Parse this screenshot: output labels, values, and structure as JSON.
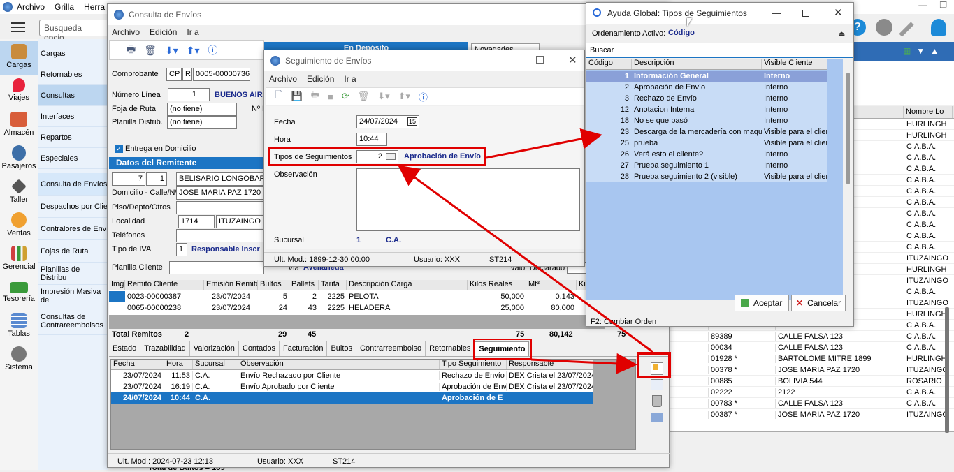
{
  "app_menu": [
    "Archivo",
    "Grilla",
    "Herra"
  ],
  "search_placeholder": "Busqueda opcio",
  "sidebar": [
    "Cargas",
    "Viajes",
    "Almacén",
    "Pasajeros",
    "Taller",
    "Ventas",
    "Gerencial",
    "Tesorería",
    "Tablas",
    "Sistema"
  ],
  "submenu1": [
    "Cargas",
    "Retornables",
    "Consultas",
    "Interfaces",
    "Repartos",
    "Especiales"
  ],
  "submenu2": [
    "Consulta de Envíos",
    "Despachos por Clie",
    "Contralores de Env",
    "Fojas de Ruta",
    "Planillas de Distribu",
    "Impresión Masiva de",
    "Consultas de Contrareembolsos"
  ],
  "bg_grid": {
    "header": "Nombre Lo",
    "rows": [
      [
        "",
        "",
        "HURLINGH"
      ],
      [
        "",
        "",
        "HURLINGH"
      ],
      [
        "",
        "",
        "C.A.B.A."
      ],
      [
        "",
        "",
        "C.A.B.A."
      ],
      [
        "",
        "",
        "C.A.B.A."
      ],
      [
        "",
        "",
        "C.A.B.A."
      ],
      [
        "",
        "",
        "C.A.B.A."
      ],
      [
        "",
        "1899",
        "C.A.B.A."
      ],
      [
        "",
        "1899",
        "C.A.B.A."
      ],
      [
        "",
        "",
        "C.A.B.A."
      ],
      [
        "",
        "",
        "C.A.B.A."
      ],
      [
        "",
        "",
        "C.A.B.A."
      ],
      [
        "",
        "",
        "ITUZAINGO"
      ],
      [
        "",
        "",
        "HURLINGH"
      ],
      [
        "",
        "",
        "ITUZAINGO"
      ],
      [
        "",
        "",
        "C.A.B.A."
      ],
      [
        "",
        "",
        "ITUZAINGO"
      ],
      [
        "",
        "1899",
        "HURLINGH"
      ],
      [
        "00012",
        "1",
        "C.A.B.A."
      ],
      [
        "89389",
        "CALLE FALSA 123",
        "C.A.B.A."
      ],
      [
        "00034",
        "CALLE FALSA 123",
        "C.A.B.A."
      ],
      [
        "01928 *",
        "BARTOLOME MITRE 1899",
        "HURLINGH"
      ],
      [
        "00378 *",
        "JOSE MARIA PAZ 1720",
        "ITUZAINGO"
      ],
      [
        "00885",
        "BOLIVIA 544",
        "ROSARIO"
      ],
      [
        "02222",
        "2122",
        "C.A.B.A."
      ],
      [
        "00783 *",
        "CALLE FALSA 123",
        "C.A.B.A."
      ],
      [
        "00387 *",
        "JOSE MARIA PAZ 1720",
        "ITUZAINGO"
      ]
    ],
    "footer": "Total de Bultos = 185"
  },
  "consulta": {
    "title": "Consulta de Envíos",
    "menu": [
      "Archivo",
      "Edición",
      "Ir a"
    ],
    "tab_deposito": "En Depósito",
    "tab_novedades": "Novedades",
    "comprobante_label": "Comprobante",
    "cp": "CP",
    "r": "R",
    "numero": "0005-00000736",
    "numero_linea_label": "Número Línea",
    "numero_linea": "1",
    "linea_name": "BUENOS AIRE",
    "foja_label": "Foja de Ruta",
    "foja": "(no tiene)",
    "nro_label": "Nº F",
    "planilla_label": "Planilla Distrib.",
    "planilla": "(no tiene)",
    "entrega_label": "Entrega en Domicilio",
    "remitente_header": "Datos del Remitente",
    "rem_a": "7",
    "rem_b": "1",
    "rem_name": "BELISARIO LONGOBARDI",
    "domicilio_label": "Domicilio - Calle/Nº",
    "domicilio": "JOSE MARIA PAZ 1720",
    "piso_label": "Piso/Depto/Otros",
    "localidad_label": "Localidad",
    "cp_loc": "1714",
    "localidad": "ITUZAINGO",
    "telefonos_label": "Teléfonos",
    "iva_label": "Tipo de IVA",
    "iva_code": "1",
    "iva_name": "Responsable Inscr",
    "planilla_cliente_label": "Planilla Cliente",
    "via_label": "Via",
    "via": "Avellaneda",
    "valor_label": "Valor Declarado",
    "remitos_header": [
      "Img",
      "Remito Cliente",
      "Emisión Remito",
      "Bultos",
      "Pallets",
      "Tarifa",
      "Descripción Carga",
      "Kilos Reales",
      "Mt³",
      "Kilo"
    ],
    "remitos": [
      [
        "",
        "0023-00000387",
        "23/07/2024",
        "5",
        "2",
        "2225",
        "PELOTA",
        "50,000",
        "0,143"
      ],
      [
        "",
        "0065-00000238",
        "23/07/2024",
        "24",
        "43",
        "2225",
        "HELADERA",
        "25,000",
        "80,000"
      ]
    ],
    "total_label": "Total Remitos",
    "total_count": "2",
    "total_bultos": "29",
    "total_pallets": "45",
    "total_kilos": "75",
    "total_mt": "80,142",
    "total_last": "75",
    "bottom_tabs": [
      "Estado",
      "Trazabilidad",
      "Valorización",
      "Contados",
      "Facturación",
      "Bultos",
      "Contrarreembolso",
      "Retornables",
      "Seguimiento"
    ],
    "seg_header": [
      "Fecha",
      "Hora",
      "Sucursal",
      "Observación",
      "Tipo Seguimiento",
      "Responsable"
    ],
    "seg_rows": [
      [
        "23/07/2024",
        "11:53",
        "C.A.",
        "Envío Rechazado por Cliente",
        "Rechazo de Envío",
        "DEX Crista el 23/07/2024"
      ],
      [
        "23/07/2024",
        "16:19",
        "C.A.",
        "Envío Aprobado por Cliente",
        "Aprobación de Envío",
        "DEX Crista el 23/07/2024"
      ],
      [
        "24/07/2024",
        "10:44",
        "C.A.",
        "",
        "Aprobación de E",
        ""
      ]
    ],
    "ult_mod": "Ult. Mod.: 2024-07-23 12:13",
    "usuario": "Usuario: XXX",
    "st": "ST214"
  },
  "seguimiento": {
    "title": "Seguimiento de Envíos",
    "menu": [
      "Archivo",
      "Edición",
      "Ir a"
    ],
    "fecha_label": "Fecha",
    "fecha": "24/07/2024",
    "hora_label": "Hora",
    "hora": "10:44",
    "tipos_label": "Tipos de Seguimientos",
    "tipo_code": "2",
    "tipo_name": "Aprobación de Envío",
    "obs_label": "Observación",
    "sucursal_label": "Sucursal",
    "sucursal_code": "1",
    "sucursal_name": "C.A.",
    "ult_mod": "Ult. Mod.: 1899-12-30 00:00",
    "usuario": "Usuario: XXX",
    "st": "ST214"
  },
  "ayuda": {
    "title": "Ayuda Global: Tipos de Seguimientos",
    "orden_label": "Ordenamiento Activo:",
    "orden_value": "Código",
    "buscar_label": "Buscar",
    "header": [
      "Código",
      "Descripción",
      "Visible Cliente"
    ],
    "rows": [
      [
        "1",
        "Información General",
        "Interno"
      ],
      [
        "2",
        "Aprobación de Envío",
        "Interno"
      ],
      [
        "3",
        "Rechazo de Envío",
        "Interno"
      ],
      [
        "12",
        "Anotacion Interna",
        "Interno"
      ],
      [
        "18",
        "No se que pasó",
        "Interno"
      ],
      [
        "23",
        "Descarga de la mercadería con maquin",
        "Visible para el client"
      ],
      [
        "25",
        "prueba",
        "Visible para el client"
      ],
      [
        "26",
        "Verá esto el cliente?",
        "Interno"
      ],
      [
        "27",
        "Prueba seguimiento 1",
        "Interno"
      ],
      [
        "28",
        "Prueba seguimiento 2 (visible)",
        "Visible para el client"
      ]
    ],
    "aceptar": "Aceptar",
    "cancelar": "Cancelar",
    "f2": "F2: Cambiar Orden"
  },
  "colors": {
    "accent": "#1c75c4",
    "selection": "#0a84c9",
    "red": "#e00000",
    "nav_blue": "#2f6cb5"
  }
}
